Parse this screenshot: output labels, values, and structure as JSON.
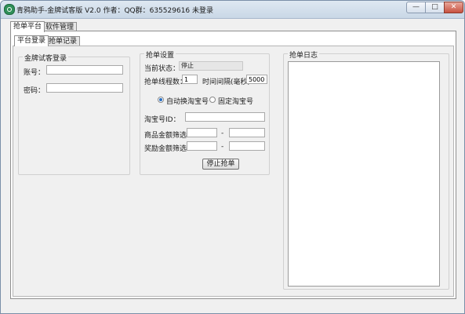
{
  "window": {
    "title": "青鸦助手-金牌试客版 V2.0 作者：QQ群：635529616 未登录",
    "icon": "app-icon",
    "controls": {
      "minimize": "—",
      "maximize": "□",
      "close": "✕"
    }
  },
  "main_tabs": [
    "抢单平台",
    "软件管理"
  ],
  "sub_tabs": [
    "平台登录",
    "抢单记录"
  ],
  "login": {
    "title": "金牌试客登录",
    "account_label": "账号：",
    "account_value": "",
    "password_label": "密码：",
    "password_value": ""
  },
  "settings": {
    "title": "抢单设置",
    "status_label": "当前状态：",
    "status_value": "停止",
    "threads_label": "抢单线程数：",
    "threads_value": "1",
    "interval_label": "时间间隔(毫秒)：",
    "interval_value": "5000",
    "radio_auto": "自动换淘宝号",
    "radio_fixed": "固定淘宝号",
    "taobao_id_label": "淘宝号ID：",
    "taobao_id_value": "",
    "goods_amount_label": "商品金额筛选：",
    "reward_amount_label": "奖励金额筛选：",
    "range_sep": "-",
    "goods_min": "",
    "goods_max": "",
    "reward_min": "",
    "reward_max": "",
    "stop_button": "停止抢单"
  },
  "log": {
    "title": "抢单日志"
  }
}
